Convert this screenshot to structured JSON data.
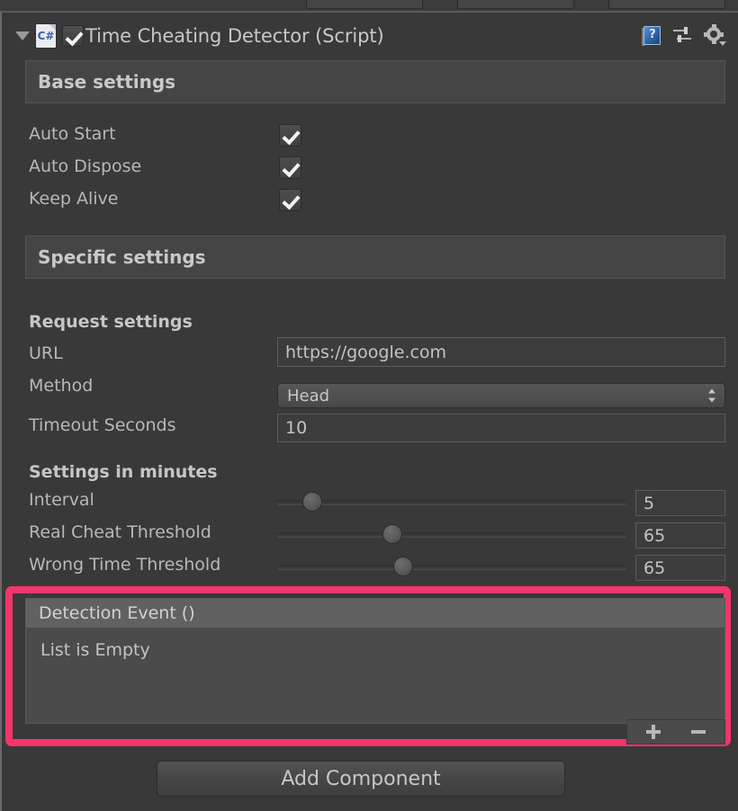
{
  "window": {
    "background": "#393939",
    "accent_highlight": "#f4356b"
  },
  "component_header": {
    "script_icon_label": "C#",
    "enabled": true,
    "title": "Time Cheating Detector (Script)",
    "icons": {
      "help": "help-book-icon",
      "presets": "presets-icon",
      "settings": "gear-dropdown-icon"
    }
  },
  "sections": {
    "base": {
      "title": "Base settings",
      "fields": [
        {
          "label": "Auto Start",
          "checked": true
        },
        {
          "label": "Auto Dispose",
          "checked": true
        },
        {
          "label": "Keep Alive",
          "checked": true
        }
      ]
    },
    "specific": {
      "title": "Specific settings",
      "request": {
        "heading": "Request settings",
        "url": {
          "label": "URL",
          "value": "https://google.com"
        },
        "method": {
          "label": "Method",
          "value": "Head"
        },
        "timeout": {
          "label": "Timeout Seconds",
          "value": "10"
        }
      },
      "minutes": {
        "heading": "Settings in minutes",
        "sliders": [
          {
            "label": "Interval",
            "value": "5",
            "percent": 10
          },
          {
            "label": "Real Cheat Threshold",
            "value": "65",
            "percent": 33
          },
          {
            "label": "Wrong Time Threshold",
            "value": "65",
            "percent": 36
          }
        ]
      }
    }
  },
  "detection_event": {
    "header": "Detection Event ()",
    "empty_text": "List is Empty",
    "add_label": "+",
    "remove_label": "−"
  },
  "footer": {
    "add_component_label": "Add Component"
  }
}
